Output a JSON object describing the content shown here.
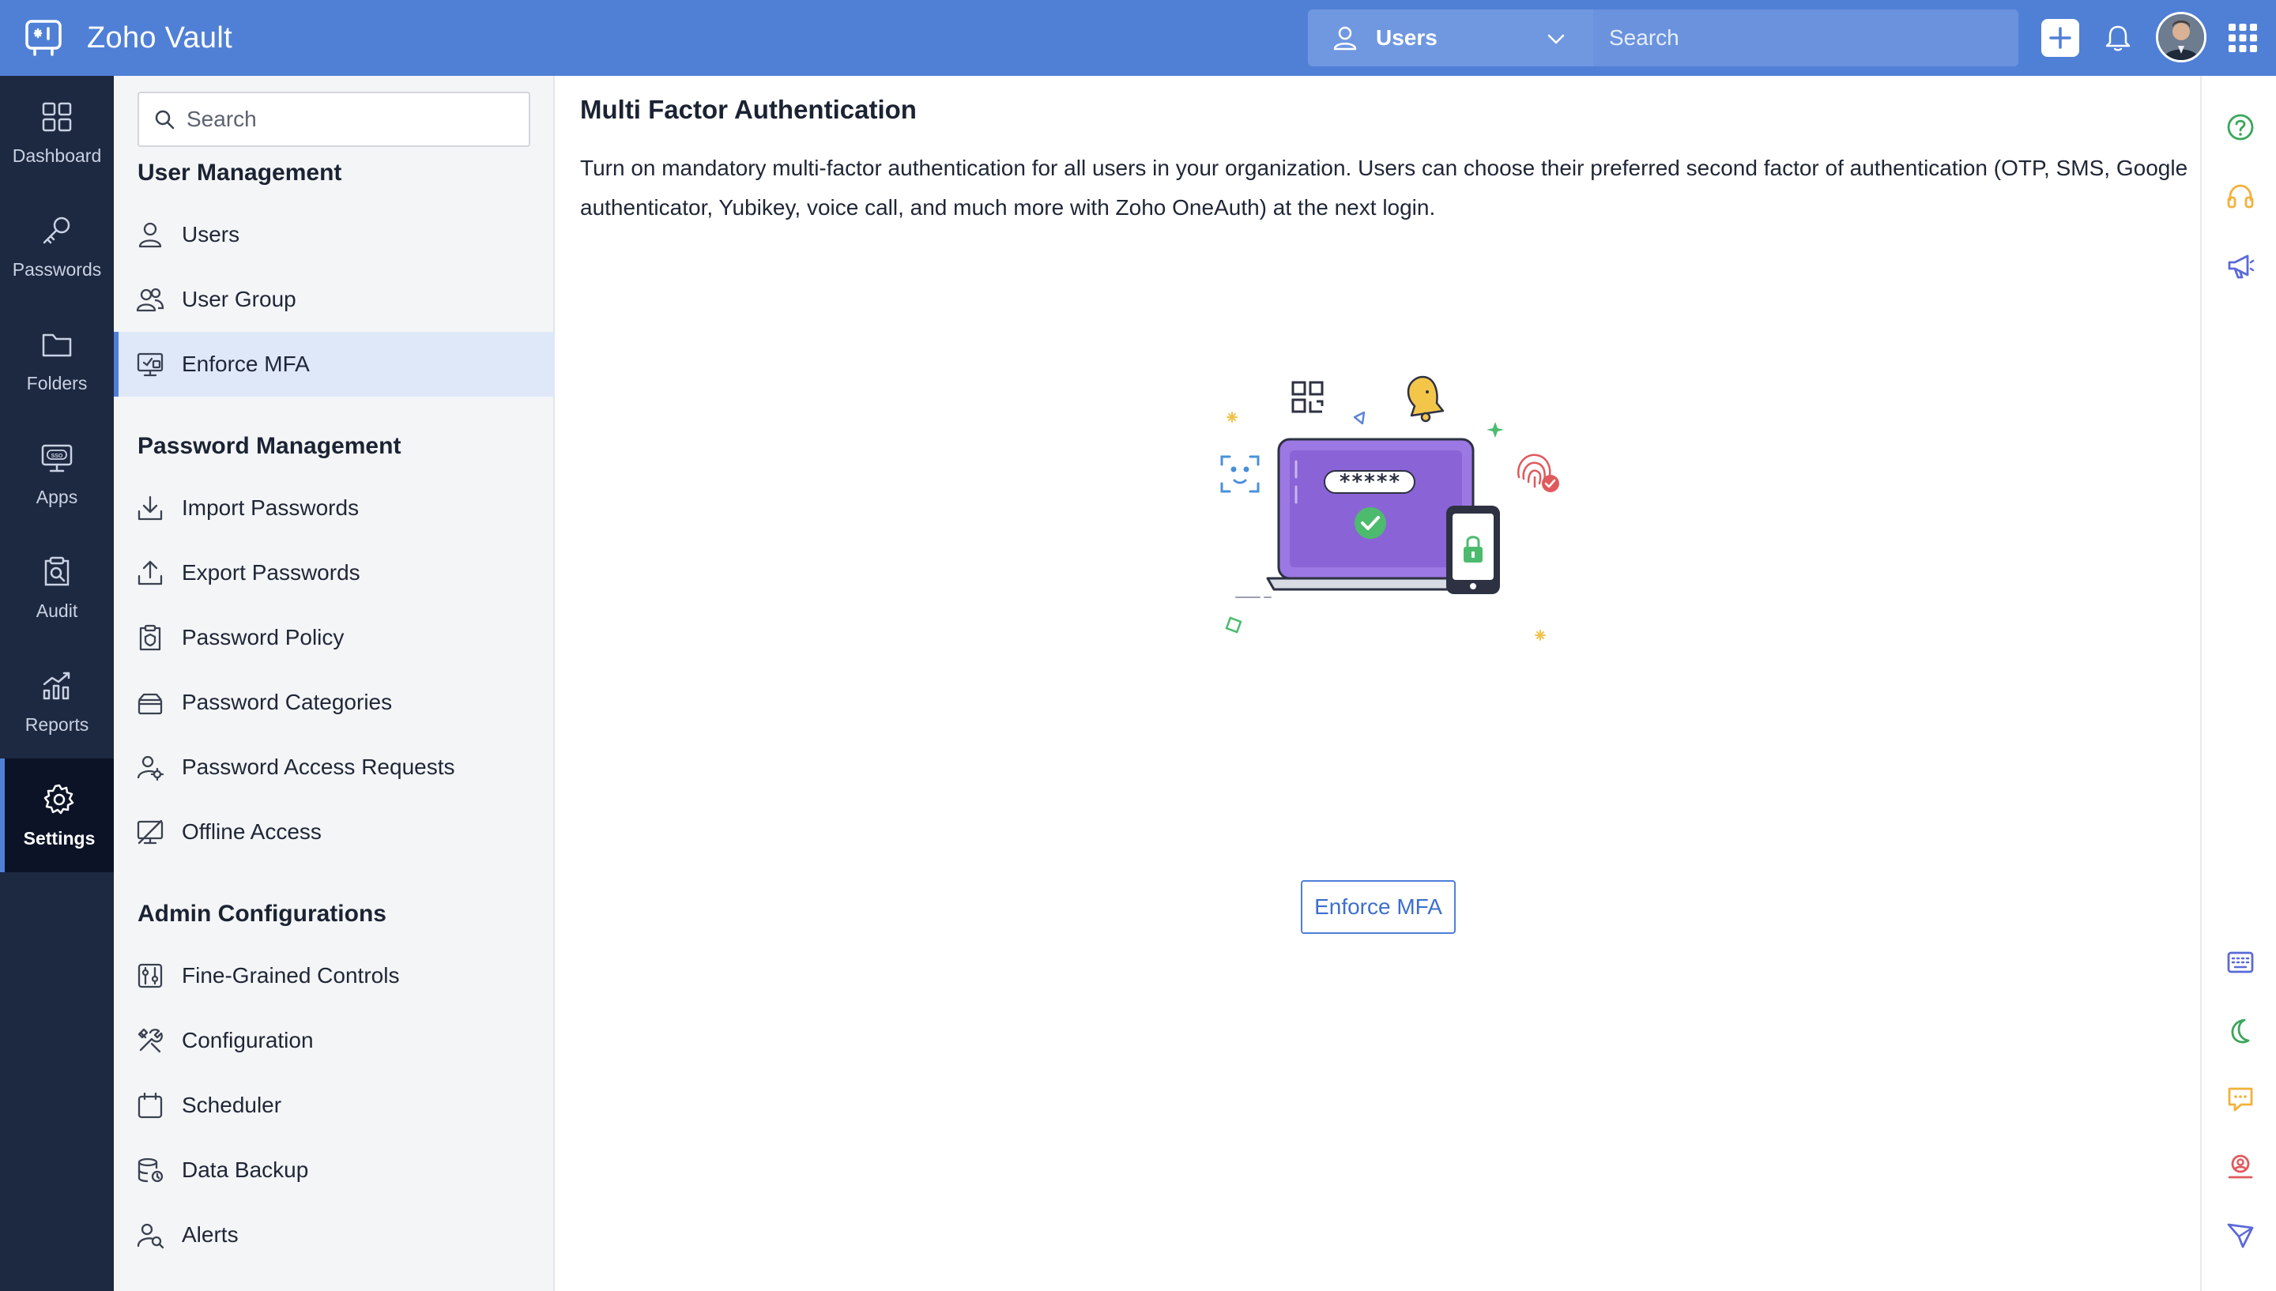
{
  "app": {
    "name": "Zoho Vault"
  },
  "topbar": {
    "module_label": "Users",
    "search_placeholder": "Search"
  },
  "rail": {
    "items": [
      {
        "label": "Dashboard",
        "icon": "dashboard-icon"
      },
      {
        "label": "Passwords",
        "icon": "key-icon"
      },
      {
        "label": "Folders",
        "icon": "folder-icon"
      },
      {
        "label": "Apps",
        "icon": "sso-icon"
      },
      {
        "label": "Audit",
        "icon": "audit-icon"
      },
      {
        "label": "Reports",
        "icon": "reports-icon"
      },
      {
        "label": "Settings",
        "icon": "gear-icon",
        "active": true
      }
    ]
  },
  "sidebar": {
    "search_placeholder": "Search",
    "sections": [
      {
        "title": "User Management",
        "items": [
          "Users",
          "User Group",
          "Enforce MFA"
        ]
      },
      {
        "title": "Password Management",
        "items": [
          "Import Passwords",
          "Export Passwords",
          "Password Policy",
          "Password Categories",
          "Password Access Requests",
          "Offline Access"
        ]
      },
      {
        "title": "Admin Configurations",
        "items": [
          "Fine-Grained Controls",
          "Configuration",
          "Scheduler",
          "Data Backup",
          "Alerts"
        ]
      }
    ],
    "active_item": "Enforce MFA"
  },
  "main": {
    "title": "Multi Factor Authentication",
    "description": "Turn on mandatory multi-factor authentication for all users in your organization. Users can choose their preferred second factor of authentication (OTP, SMS, Google authenticator, Yubikey, voice call, and much more with Zoho OneAuth) at the next login.",
    "illustration_password": "*****",
    "button_label": "Enforce MFA"
  },
  "colors": {
    "topbar": "#5080d6",
    "rail": "#1d2841",
    "accent": "#4f7fd6",
    "laptop": "#8e6ad8"
  }
}
